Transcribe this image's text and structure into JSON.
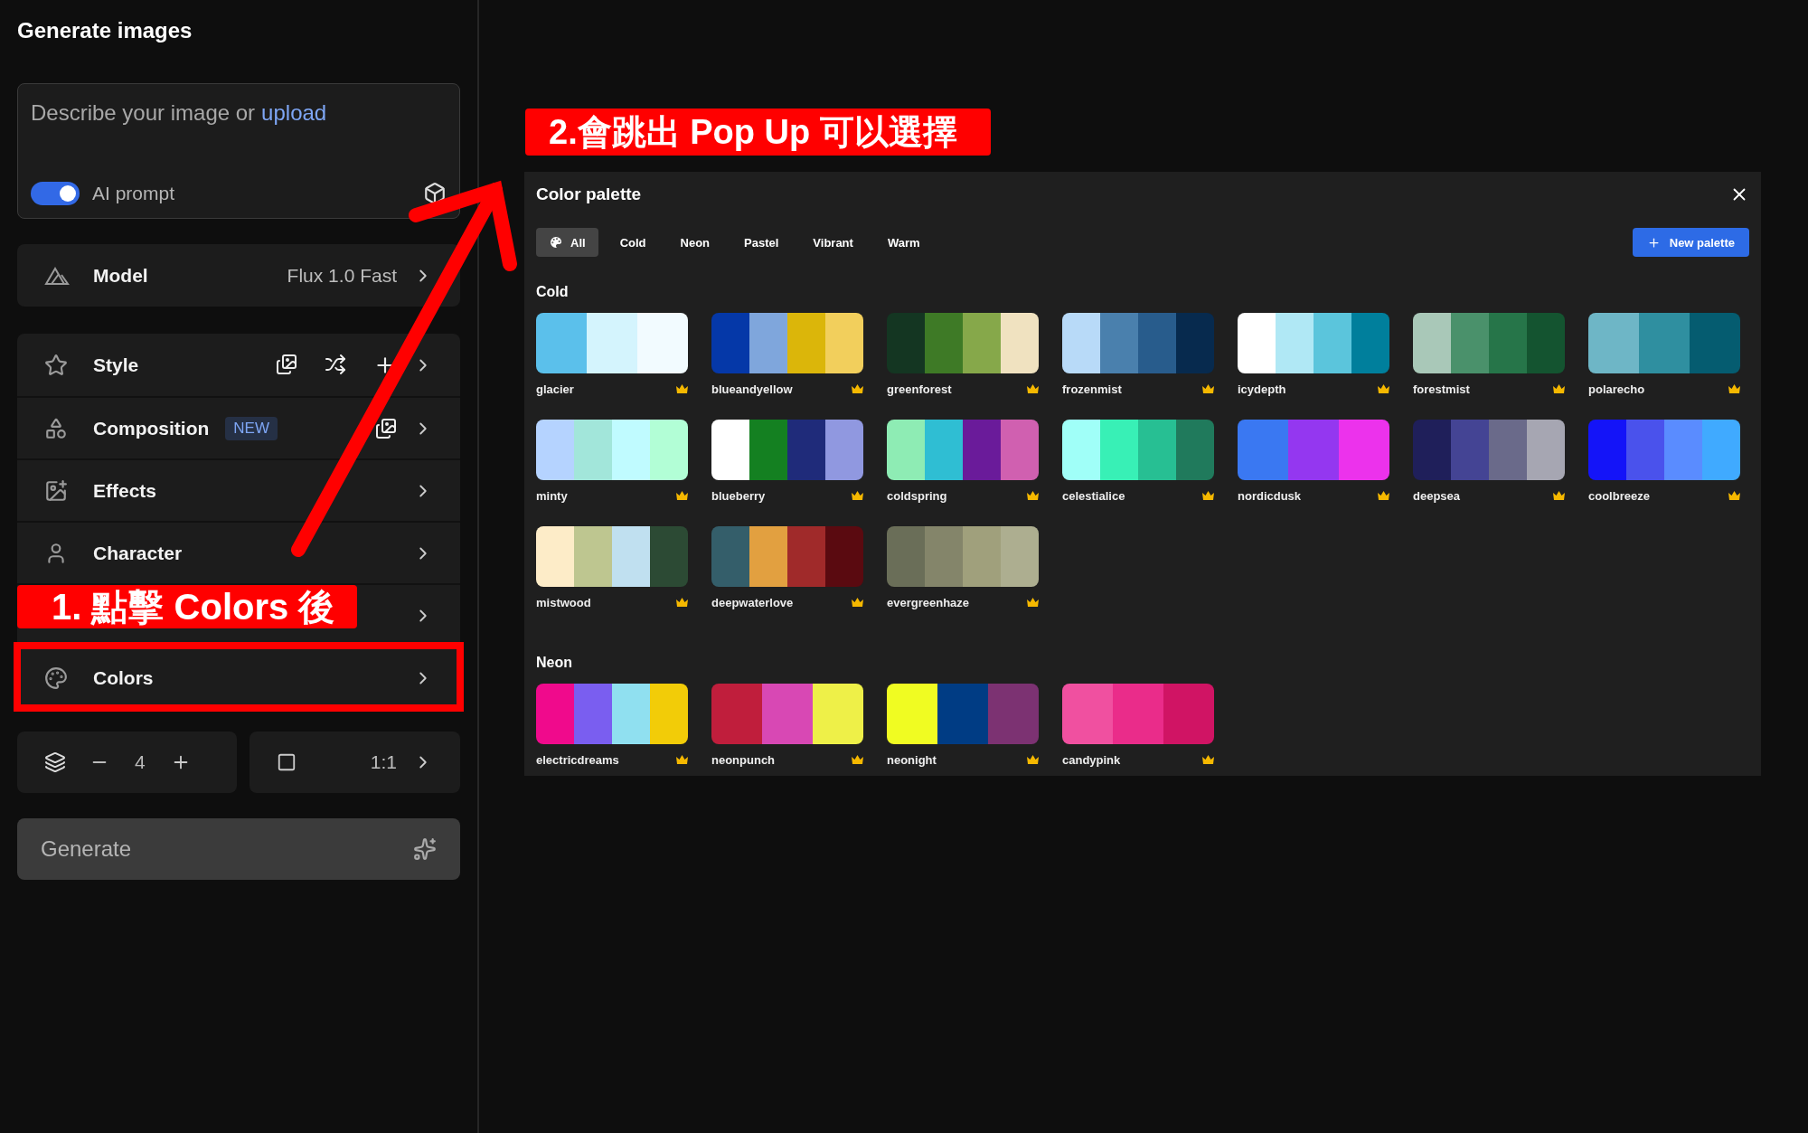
{
  "sidebar": {
    "title": "Generate images",
    "prompt": {
      "placeholder": "Describe your image or",
      "link": "upload",
      "ai_prompt": {
        "label": "AI prompt",
        "on": true
      }
    },
    "model": {
      "label": "Model",
      "value": "Flux 1.0 Fast"
    },
    "options": [
      {
        "kind": "style",
        "label": "Style",
        "highlighted": false
      },
      {
        "kind": "composition",
        "label": "Composition",
        "badge": "NEW",
        "highlighted": false
      },
      {
        "kind": "effects",
        "label": "Effects",
        "highlighted": false
      },
      {
        "kind": "character",
        "label": "Character",
        "highlighted": false
      },
      {
        "kind": "covered",
        "highlighted": false
      },
      {
        "kind": "colors",
        "label": "Colors",
        "highlighted": true
      }
    ],
    "count": "4",
    "ratio": "1:1",
    "generate": "Generate"
  },
  "annotations": [
    {
      "kind": "step-one",
      "text": "1. 點擊 Colors 後"
    },
    {
      "kind": "step-two",
      "text": "2.會跳出 Pop Up 可以選擇"
    }
  ],
  "dialog": {
    "title": "Color palette",
    "tabs": [
      {
        "label": "All",
        "selected": true
      },
      {
        "label": "Cold",
        "selected": false
      },
      {
        "label": "Neon",
        "selected": false
      },
      {
        "label": "Pastel",
        "selected": false
      },
      {
        "label": "Vibrant",
        "selected": false
      },
      {
        "label": "Warm",
        "selected": false
      }
    ],
    "new_button": "New palette",
    "sections": [
      {
        "heading": "Cold",
        "palettes": [
          {
            "name": "glacier",
            "stripes": [
              {
                "color": "#5bc0eb"
              },
              {
                "color": "#d4f4fd"
              },
              {
                "color": "#f2fbff"
              }
            ]
          },
          {
            "name": "blueandyellow",
            "stripes": [
              {
                "color": "#0538a8"
              },
              {
                "color": "#7fa6dc"
              },
              {
                "color": "#dbb60a"
              },
              {
                "color": "#f2cf5c"
              }
            ]
          },
          {
            "name": "greenforest",
            "stripes": [
              {
                "color": "#143622"
              },
              {
                "color": "#3e7a26"
              },
              {
                "color": "#86a84a"
              },
              {
                "color": "#f0e2c0"
              }
            ]
          },
          {
            "name": "frozenmist",
            "stripes": [
              {
                "color": "#b8daf8"
              },
              {
                "color": "#4a80ad"
              },
              {
                "color": "#285c8c"
              },
              {
                "color": "#072a4e"
              }
            ]
          },
          {
            "name": "icydepth",
            "stripes": [
              {
                "color": "#ffffff"
              },
              {
                "color": "#b0e8f5"
              },
              {
                "color": "#5bc5dc"
              },
              {
                "color": "#007f9c"
              }
            ]
          },
          {
            "name": "forestmist",
            "stripes": [
              {
                "color": "#a9c8b8"
              },
              {
                "color": "#4a916b"
              },
              {
                "color": "#267549"
              },
              {
                "color": "#145430"
              }
            ]
          },
          {
            "name": "polarecho",
            "stripes": [
              {
                "color": "#6eb6c6"
              },
              {
                "color": "#2f8fa0"
              },
              {
                "color": "#055c70"
              }
            ]
          },
          {
            "name": "minty",
            "stripes": [
              {
                "color": "#b5d3ff"
              },
              {
                "color": "#a2e6da"
              },
              {
                "color": "#c0fbff"
              },
              {
                "color": "#b2fed6"
              }
            ]
          },
          {
            "name": "blueberry",
            "stripes": [
              {
                "color": "#ffffff"
              },
              {
                "color": "#148021"
              },
              {
                "color": "#1f2b7a"
              },
              {
                "color": "#9098e0"
              }
            ]
          },
          {
            "name": "coldspring",
            "stripes": [
              {
                "color": "#8eecb4"
              },
              {
                "color": "#2fbed3"
              },
              {
                "color": "#6a1b9a"
              },
              {
                "color": "#d060b0"
              }
            ]
          },
          {
            "name": "celestialice",
            "stripes": [
              {
                "color": "#a0fff8"
              },
              {
                "color": "#38f0b6"
              },
              {
                "color": "#27bf93"
              },
              {
                "color": "#207a5c"
              }
            ]
          },
          {
            "name": "nordicdusk",
            "stripes": [
              {
                "color": "#3a78f2"
              },
              {
                "color": "#9437f0"
              },
              {
                "color": "#ec32ec"
              }
            ]
          },
          {
            "name": "deepsea",
            "stripes": [
              {
                "color": "#1f1f5a"
              },
              {
                "color": "#444494"
              },
              {
                "color": "#6a6a8a"
              },
              {
                "color": "#a6a6b2"
              }
            ]
          },
          {
            "name": "coolbreeze",
            "stripes": [
              {
                "color": "#1414f8"
              },
              {
                "color": "#4a52ec"
              },
              {
                "color": "#5a8cff"
              },
              {
                "color": "#40aaff"
              }
            ]
          },
          {
            "name": "mistwood",
            "stripes": [
              {
                "color": "#fdecc8"
              },
              {
                "color": "#bec690"
              },
              {
                "color": "#c0e0f0"
              },
              {
                "color": "#2c4a34"
              }
            ]
          },
          {
            "name": "deepwaterlove",
            "stripes": [
              {
                "color": "#345e6a"
              },
              {
                "color": "#e2a040"
              },
              {
                "color": "#a02a2a"
              },
              {
                "color": "#5a0a10"
              }
            ]
          },
          {
            "name": "evergreenhaze",
            "stripes": [
              {
                "color": "#6a6e58"
              },
              {
                "color": "#84856a"
              },
              {
                "color": "#a0a07c"
              },
              {
                "color": "#adae90"
              }
            ]
          }
        ]
      },
      {
        "heading": "Neon",
        "palettes": [
          {
            "name": "electricdreams",
            "stripes": [
              {
                "color": "#f00a8c"
              },
              {
                "color": "#7a5ef0"
              },
              {
                "color": "#90e0f0"
              },
              {
                "color": "#f2cc08"
              }
            ]
          },
          {
            "name": "neonpunch",
            "stripes": [
              {
                "color": "#c01e3c"
              },
              {
                "color": "#d848b4"
              },
              {
                "color": "#eef048"
              }
            ]
          },
          {
            "name": "neonight",
            "stripes": [
              {
                "color": "#f0fc22"
              },
              {
                "color": "#003c84"
              },
              {
                "color": "#7c3272"
              }
            ]
          },
          {
            "name": "candypink",
            "stripes": [
              {
                "color": "#f050a0"
              },
              {
                "color": "#ea2c8a"
              },
              {
                "color": "#d01464"
              }
            ]
          }
        ]
      }
    ]
  }
}
